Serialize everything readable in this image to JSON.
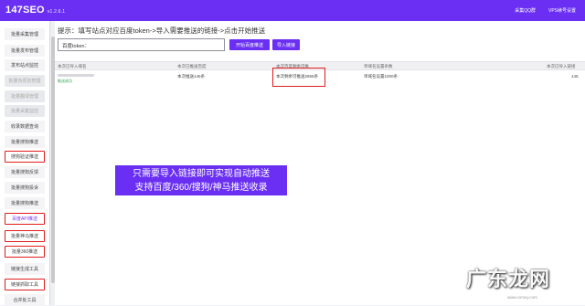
{
  "app": {
    "name": "147SEO",
    "version": "v1.2.6.1"
  },
  "top_links": [
    "采集QQ群",
    "VPS续号设置"
  ],
  "sidebar": {
    "items": [
      {
        "label": "批量采集管理",
        "state": "normal"
      },
      {
        "label": "批量发布管理",
        "state": "normal"
      },
      {
        "label": "发布站点监控",
        "state": "normal"
      },
      {
        "label": "批量伪原创管理",
        "state": "muted"
      },
      {
        "label": "批量翻译管理",
        "state": "muted"
      },
      {
        "label": "批量采集监控",
        "state": "muted"
      },
      {
        "label": "收录数据查询",
        "state": "normal"
      },
      {
        "label": "批量搜狗推送",
        "state": "normal"
      },
      {
        "label": "搜狗验证推送",
        "state": "highlight"
      },
      {
        "label": "批量搜狗反馈",
        "state": "normal"
      },
      {
        "label": "批量搜狗投诉",
        "state": "normal"
      },
      {
        "label": "批量搜狗推送",
        "state": "normal"
      },
      {
        "label": "百度API推送",
        "state": "highlight-active"
      },
      {
        "label": "批量神马推送",
        "state": "highlight"
      },
      {
        "label": "批量360推送",
        "state": "highlight"
      },
      {
        "label": "链接生成工具",
        "state": "normal"
      },
      {
        "label": "链接抓取工具",
        "state": "highlight"
      },
      {
        "label": "合并处工具",
        "state": "normal"
      }
    ]
  },
  "main": {
    "tip": "提示：填写站点对应百度token->导入需要推送的链接->点击开始推送",
    "url_input": {
      "value": "百度token：",
      "placeholder": ""
    },
    "buttons": {
      "start": "开始百度推送",
      "import": "导入链接"
    },
    "table": {
      "headers": [
        "本次已导入域名",
        "本次已推送百度",
        "本次百度剩余可推",
        "单域名设置条数",
        "本次已导入链接"
      ],
      "rows": [
        {
          "status": "推送成功",
          "pushed": "本次推送145条",
          "remaining": "本次剩余可推送2855条",
          "setting": "单域名设置1000条",
          "imported": "145"
        }
      ]
    }
  },
  "callout": {
    "line1": "只需要导入链接即可实现自动推送",
    "line2": "支持百度/360/搜狗/神马推送收录"
  },
  "watermark": {
    "text": "广东龙网",
    "url": "www.cxmxy.com"
  },
  "colors": {
    "accent": "#6a2ff3",
    "highlight": "#e01c1c",
    "success": "#2da44e"
  }
}
